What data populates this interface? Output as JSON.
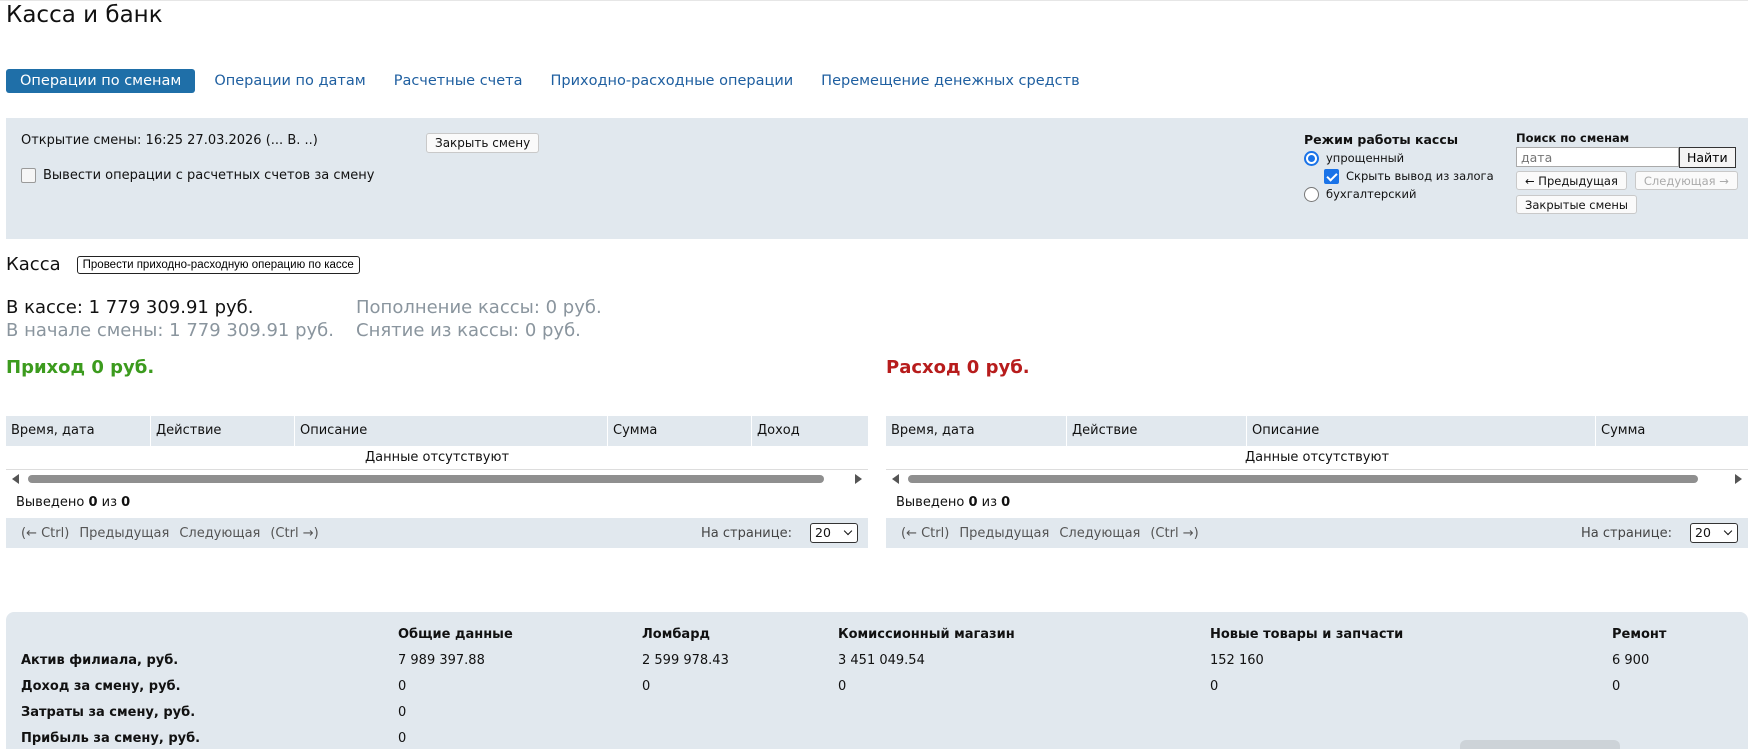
{
  "page": {
    "title": "Касса и банк"
  },
  "tabs": [
    {
      "label": "Операции по сменам",
      "active": true
    },
    {
      "label": "Операции по датам",
      "active": false
    },
    {
      "label": "Расчетные счета",
      "active": false
    },
    {
      "label": "Приходно-расходные операции",
      "active": false
    },
    {
      "label": "Перемещение денежных средств",
      "active": false
    }
  ],
  "shift": {
    "open_text": "Открытие смены: 16:25 27.03.2026 (... В. ..)",
    "close_button": "Закрыть смену",
    "show_accounts_label": "Вывести операции с расчетных счетов за смену",
    "show_accounts_checked": false
  },
  "mode": {
    "title": "Режим работы кассы",
    "simplified": "упрощенный",
    "simplified_selected": true,
    "hide_pledge": "Скрыть вывод из залога",
    "hide_pledge_checked": true,
    "accounting": "бухгалтерский",
    "accounting_selected": false
  },
  "search": {
    "title": "Поиск по сменам",
    "placeholder": "дата",
    "find_button": "Найти",
    "prev_button": "← Предыдущая",
    "next_button": "Следующая →",
    "closed_button": "Закрытые смены"
  },
  "kassa": {
    "title": "Касса",
    "operation_button": "Провести приходно-расходную операцию по кассе",
    "in_cash": "В кассе: 1 779 309.91 руб.",
    "at_start": "В начале смены: 1 779 309.91 руб.",
    "replenish": "Пополнение кассы: 0 руб.",
    "withdraw": "Снятие из кассы: 0 руб."
  },
  "income": {
    "title": "Приход 0 руб.",
    "columns": [
      "Время, дата",
      "Действие",
      "Описание",
      "Сумма",
      "Доход"
    ],
    "empty": "Данные отсутствуют",
    "shown_prefix": "Выведено",
    "shown_count": "0",
    "shown_of": "из",
    "shown_total": "0"
  },
  "expense": {
    "title": "Расход 0 руб.",
    "columns": [
      "Время, дата",
      "Действие",
      "Описание",
      "Сумма"
    ],
    "empty": "Данные отсутствуют",
    "shown_prefix": "Выведено",
    "shown_count": "0",
    "shown_of": "из",
    "shown_total": "0"
  },
  "pager": {
    "ctrl_left": "(← Ctrl)",
    "prev": "Предыдущая",
    "next": "Следующая",
    "ctrl_right": "(Ctrl →)",
    "per_page_label": "На странице:",
    "per_page_value": "20"
  },
  "summary": {
    "columns": [
      "Общие данные",
      "Ломбард",
      "Комиссионный магазин",
      "Новые товары и запчасти",
      "Ремонт"
    ],
    "rows": [
      {
        "label": "Актив филиала, руб.",
        "values": [
          "7 989 397.88",
          "2 599 978.43",
          "3 451 049.54",
          "152 160",
          "6 900"
        ]
      },
      {
        "label": "Доход за смену, руб.",
        "values": [
          "0",
          "0",
          "0",
          "0",
          "0"
        ]
      },
      {
        "label": "Затраты за смену, руб.",
        "values": [
          "0",
          "",
          "",
          "",
          ""
        ]
      },
      {
        "label": "Прибыль за смену, руб.",
        "values": [
          "0",
          "",
          "",
          "",
          ""
        ]
      }
    ]
  },
  "colors": {
    "accent": "#1f6fa8",
    "panel": "#e1e8ee",
    "income": "#3c9b1e",
    "expense": "#b71c1c"
  }
}
